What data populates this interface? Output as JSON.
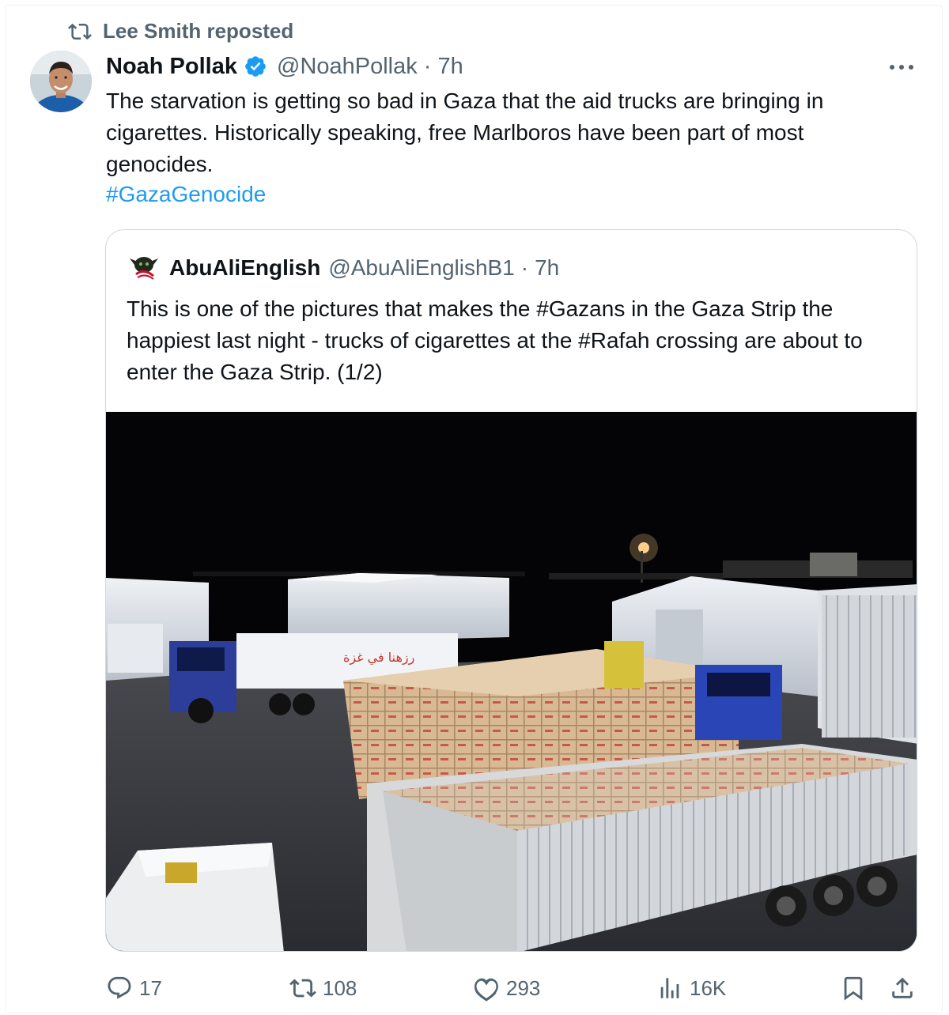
{
  "repost": {
    "icon": "repost-icon",
    "label": "Lee Smith reposted"
  },
  "tweet": {
    "author": "Noah Pollak",
    "handle": "@NoahPollak",
    "separator": "·",
    "time": "7h",
    "verified": true,
    "text": "The starvation is getting so bad in Gaza that the aid trucks are bringing in cigarettes. Historically speaking, free Marlboros have been part of most genocides.",
    "hashtag": "#GazaGenocide"
  },
  "quote": {
    "author": "AbuAliEnglish",
    "handle": "@AbuAliEnglishB1",
    "separator": "·",
    "time": "7h",
    "text": "This is one of the pictures that makes the #Gazans in the Gaza Strip the happiest last night - trucks of cigarettes at the #Rafah crossing are about to enter the Gaza Strip. (1/2)",
    "truck_sign": "رزهنا في غزة"
  },
  "actions": {
    "replies": "17",
    "reposts": "108",
    "likes": "293",
    "views": "16K"
  },
  "colors": {
    "text": "#0f1419",
    "secondary": "#536471",
    "link": "#1d9bf0",
    "border": "#cfd9de",
    "verified": "#1d9bf0"
  }
}
